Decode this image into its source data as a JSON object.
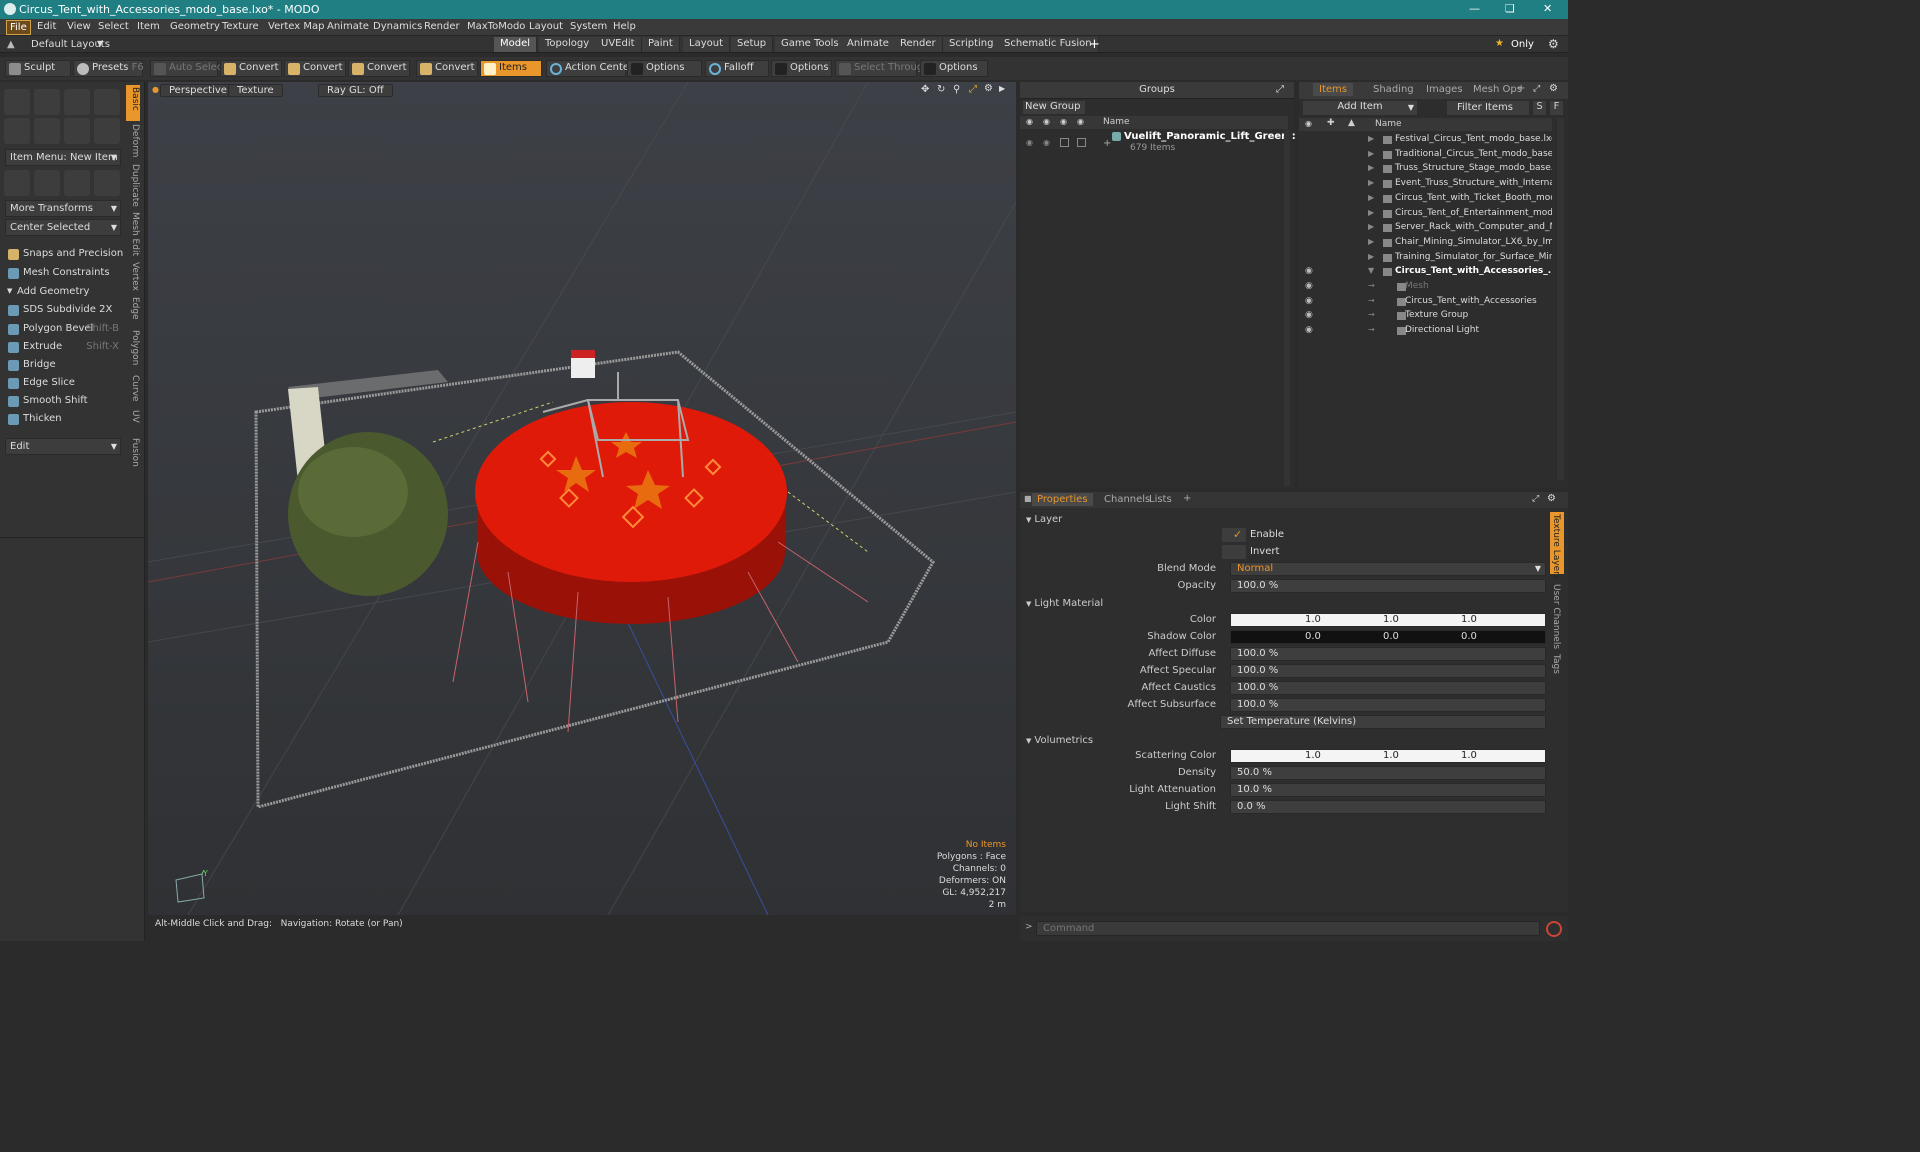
{
  "window": {
    "title": "Circus_Tent_with_Accessories_modo_base.lxo* - MODO"
  },
  "menubar": {
    "items": [
      "File",
      "Edit",
      "View",
      "Select",
      "Item",
      "Geometry",
      "Texture",
      "Vertex Map",
      "Animate",
      "Dynamics",
      "Render",
      "MaxToModo",
      "Layout",
      "System",
      "Help"
    ]
  },
  "layoutbar": {
    "layout_selector": "Default Layouts",
    "tabs": [
      "Model",
      "Topology",
      "UVEdit",
      "Paint",
      "Layout",
      "Setup",
      "Game Tools",
      "Animate",
      "Render",
      "Scripting",
      "Schematic Fusion"
    ],
    "active_tab": "Model",
    "add": "+",
    "only": "Only"
  },
  "toolbar": {
    "sculpt": "Sculpt",
    "presets": "Presets",
    "presets_key": "F6",
    "auto_select": "Auto Select",
    "convert1": "Convert",
    "convert2": "Convert",
    "convert3": "Convert",
    "convert4": "Convert",
    "items": "Items",
    "action_center": "Action Center",
    "options1": "Options",
    "falloff": "Falloff",
    "options2": "Options",
    "select_through": "Select Through",
    "options3": "Options"
  },
  "leftpanel": {
    "item_menu": "Item Menu: New Item",
    "more_transforms": "More Transforms",
    "center_selected": "Center Selected",
    "snaps": "Snaps and Precision",
    "mesh_constraints": "Mesh Constraints",
    "add_geometry": "Add Geometry",
    "tools": [
      {
        "label": "SDS Subdivide 2X",
        "shortcut": ""
      },
      {
        "label": "Polygon Bevel",
        "shortcut": "Shift-B"
      },
      {
        "label": "Extrude",
        "shortcut": "Shift-X"
      },
      {
        "label": "Bridge",
        "shortcut": ""
      },
      {
        "label": "Edge Slice",
        "shortcut": ""
      },
      {
        "label": "Smooth Shift",
        "shortcut": ""
      },
      {
        "label": "Thicken",
        "shortcut": ""
      }
    ],
    "edit": "Edit",
    "side_tabs": [
      "Basic",
      "Deform",
      "Duplicate",
      "Mesh Edit",
      "Vertex",
      "Edge",
      "Polygon",
      "Curve",
      "UV",
      "Fusion"
    ]
  },
  "viewport": {
    "view": "Perspective",
    "shading": "Texture",
    "raygl": "Ray GL: Off",
    "info": {
      "selection": "No Items",
      "polygons": "Polygons : Face",
      "channels": "Channels: 0",
      "deformers": "Deformers: ON",
      "gl": "GL: 4,952,217",
      "scale": "2 m"
    },
    "axis_y": "Y",
    "status": "Alt-Middle Click and Drag:   Navigation: Rotate (or Pan)"
  },
  "groups": {
    "title": "Groups",
    "new_group": "New Group",
    "col_name": "Name",
    "group_name": "Vuelift_Panoramic_Lift_Green : ...",
    "group_count": "679 Items"
  },
  "items_panel": {
    "tabs": [
      "Items",
      "Shading",
      "Images",
      "Mesh Ops"
    ],
    "add_item": "Add Item",
    "filter": "Filter Items",
    "s": "S",
    "f": "F",
    "col_name": "Name",
    "rows": [
      {
        "name": "Festival_Circus_Tent_modo_base.lxo*",
        "indent": 0,
        "eye": false
      },
      {
        "name": "Traditional_Circus_Tent_modo_base.lxo",
        "indent": 0,
        "eye": false
      },
      {
        "name": "Truss_Structure_Stage_modo_base.lxo",
        "indent": 0,
        "eye": false
      },
      {
        "name": "Event_Truss_Structure_with_Interna...",
        "indent": 0,
        "eye": false
      },
      {
        "name": "Circus_Tent_with_Ticket_Booth_mod ...",
        "indent": 0,
        "eye": false
      },
      {
        "name": "Circus_Tent_of_Entertainment_modo...",
        "indent": 0,
        "eye": false
      },
      {
        "name": "Server_Rack_with_Computer_and_M...",
        "indent": 0,
        "eye": false
      },
      {
        "name": "Chair_Mining_Simulator_LX6_by_Imm...",
        "indent": 0,
        "eye": false
      },
      {
        "name": "Training_Simulator_for_Surface_Mini ...",
        "indent": 0,
        "eye": false
      },
      {
        "name": "Circus_Tent_with_Accessories_...",
        "indent": 0,
        "eye": true
      },
      {
        "name": "Mesh",
        "indent": 1,
        "eye": true
      },
      {
        "name": "Circus_Tent_with_Accessories",
        "indent": 1,
        "eye": true
      },
      {
        "name": "Texture Group",
        "indent": 1,
        "eye": true
      },
      {
        "name": "Directional Light",
        "indent": 1,
        "eye": true
      }
    ]
  },
  "properties": {
    "tabs": [
      "Properties",
      "Channels",
      "Lists"
    ],
    "side_tabs": [
      "Texture Layers",
      "User Channels",
      "Tags"
    ],
    "layer": {
      "title": "Layer",
      "enable": "Enable",
      "invert": "Invert",
      "blend_mode_label": "Blend Mode",
      "blend_mode": "Normal",
      "opacity_label": "Opacity",
      "opacity": "100.0 %"
    },
    "light_material": {
      "title": "Light Material",
      "color_label": "Color",
      "color": [
        "1.0",
        "1.0",
        "1.0"
      ],
      "shadow_label": "Shadow Color",
      "shadow": [
        "0.0",
        "0.0",
        "0.0"
      ],
      "diffuse_label": "Affect Diffuse",
      "diffuse": "100.0 %",
      "specular_label": "Affect Specular",
      "specular": "100.0 %",
      "caustics_label": "Affect Caustics",
      "caustics": "100.0 %",
      "subsurface_label": "Affect Subsurface",
      "subsurface": "100.0 %",
      "set_temp": "Set Temperature (Kelvins)"
    },
    "volumetrics": {
      "title": "Volumetrics",
      "scatter_label": "Scattering Color",
      "scatter": [
        "1.0",
        "1.0",
        "1.0"
      ],
      "density_label": "Density",
      "density": "50.0 %",
      "atten_label": "Light Attenuation",
      "atten": "10.0 %",
      "shift_label": "Light Shift",
      "shift": "0.0 %"
    }
  },
  "command": {
    "placeholder": "Command"
  },
  "colors": {
    "accent": "#e9962a",
    "title_bar": "#1f7f83",
    "tent_red": "#e01a08"
  }
}
